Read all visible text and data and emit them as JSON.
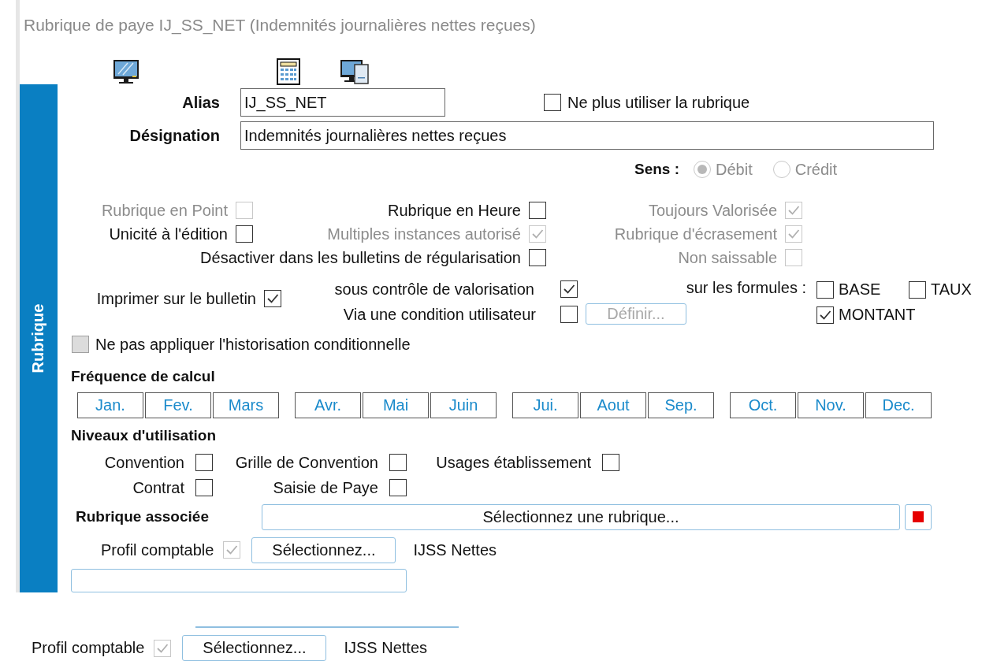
{
  "title": "Rubrique de paye IJ_SS_NET (Indemnités journalières nettes reçues)",
  "side_tab": {
    "label": "Rubrique",
    "selected": true
  },
  "alias": {
    "label": "Alias",
    "value": "IJ_SS_NET"
  },
  "designation": {
    "label": "Désignation",
    "value": "Indemnités journalières nettes reçues"
  },
  "ne_plus_utiliser": {
    "label": "Ne plus utiliser la rubrique",
    "checked": false
  },
  "sens": {
    "label": "Sens :",
    "options": [
      {
        "label": "Débit",
        "selected": true,
        "disabled": true
      },
      {
        "label": "Crédit",
        "selected": false,
        "disabled": true
      }
    ]
  },
  "option_rows": [
    [
      {
        "label": "Rubrique en Point",
        "checked": false,
        "disabled": true
      },
      {
        "label": "Rubrique en Heure",
        "checked": false,
        "disabled": false
      },
      {
        "label": "Toujours Valorisée",
        "checked": true,
        "disabled": true
      }
    ],
    [
      {
        "label": "Unicité à l'édition",
        "checked": false,
        "disabled": false
      },
      {
        "label": "Multiples instances autorisé",
        "checked": true,
        "disabled": true
      },
      {
        "label": "Rubrique d'écrasement",
        "checked": true,
        "disabled": true
      }
    ],
    [
      {
        "label": "Désactiver dans les bulletins de régularisation",
        "checked": false,
        "disabled": false
      },
      {
        "label": "Non saissable",
        "checked": false,
        "disabled": true
      }
    ]
  ],
  "imprimer": {
    "label": "Imprimer sur le bulletin",
    "checked": true
  },
  "valorisation": {
    "label": "sous contrôle de valorisation",
    "checked": true
  },
  "condition": {
    "label": "Via une condition utilisateur",
    "checked": false
  },
  "definir": {
    "label": "Définir...",
    "disabled": true
  },
  "formules": {
    "label": "sur les formules :",
    "items": [
      {
        "label": "BASE",
        "checked": false
      },
      {
        "label": "TAUX",
        "checked": false
      },
      {
        "label": "MONTANT",
        "checked": true
      }
    ]
  },
  "historisation": {
    "label": "Ne pas appliquer l'historisation conditionnelle",
    "checked": false,
    "disabled": true
  },
  "frequence": {
    "title": "Fréquence de calcul",
    "groups": [
      [
        {
          "label": "Jan."
        },
        {
          "label": "Fev."
        },
        {
          "label": "Mars"
        }
      ],
      [
        {
          "label": "Avr."
        },
        {
          "label": "Mai"
        },
        {
          "label": "Juin"
        }
      ],
      [
        {
          "label": "Jui."
        },
        {
          "label": "Aout"
        },
        {
          "label": "Sep."
        }
      ],
      [
        {
          "label": "Oct."
        },
        {
          "label": "Nov."
        },
        {
          "label": "Dec."
        }
      ]
    ]
  },
  "niveaux": {
    "title": "Niveaux d'utilisation",
    "rows": [
      [
        {
          "label": "Convention",
          "checked": false
        },
        {
          "label": "Grille de Convention",
          "checked": false
        },
        {
          "label": "Usages établissement",
          "checked": false
        }
      ],
      [
        {
          "label": "Contrat",
          "checked": false
        },
        {
          "label": "Saisie de Paye",
          "checked": false
        }
      ]
    ]
  },
  "rubrique_associee": {
    "label": "Rubrique associée",
    "button": "Sélectionnez une rubrique..."
  },
  "profil": {
    "label": "Profil comptable",
    "checked": true,
    "button": "Sélectionnez...",
    "value": "IJSS Nettes"
  },
  "footer_profil": {
    "label": "Profil comptable",
    "checked": true,
    "button": "Sélectionnez...",
    "value": "IJSS Nettes"
  }
}
